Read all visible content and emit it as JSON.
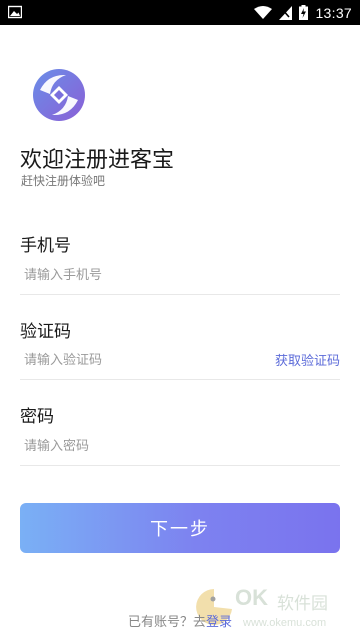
{
  "status_bar": {
    "time": "13:37",
    "icons": [
      "image-icon",
      "wifi-icon",
      "signal-icon",
      "battery-charging-icon"
    ]
  },
  "app": {
    "logo_icon": "app-logo-icon",
    "title": "欢迎注册进客宝",
    "subtitle": "赶快注册体验吧"
  },
  "form": {
    "phone": {
      "label": "手机号",
      "placeholder": "请输入手机号",
      "value": ""
    },
    "code": {
      "label": "验证码",
      "placeholder": "请输入验证码",
      "value": "",
      "get_code_label": "获取验证码"
    },
    "password": {
      "label": "密码",
      "placeholder": "请输入密码",
      "value": ""
    }
  },
  "next_button": {
    "label": "下一步"
  },
  "footer": {
    "prompt": "已有账号？去",
    "login_link": "登录"
  },
  "watermark": {
    "brand": "OK",
    "name": "软件园",
    "url": "www.okemu.com"
  },
  "colors": {
    "accent": "#5c6bd9",
    "button_gradient_start": "#7ab0f5",
    "button_gradient_end": "#7a73ee",
    "status_bar_bg": "#000000"
  }
}
